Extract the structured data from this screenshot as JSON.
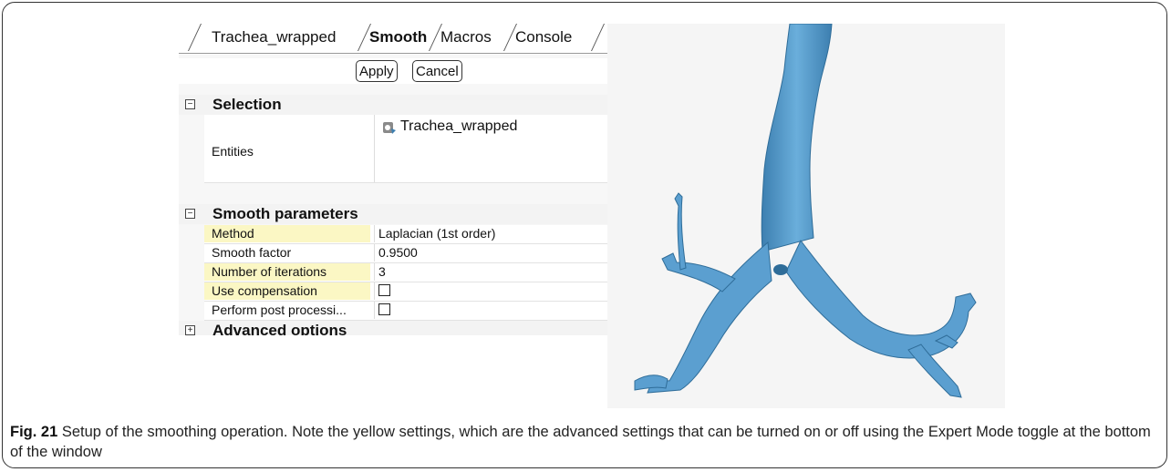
{
  "tabs": [
    "Trachea_wrapped",
    "Smooth",
    "Macros",
    "Console"
  ],
  "active_tab": "Smooth",
  "buttons": {
    "apply": "Apply",
    "cancel": "Cancel"
  },
  "sections": {
    "selection": {
      "title": "Selection",
      "toggle": "−"
    },
    "smooth_params": {
      "title": "Smooth parameters",
      "toggle": "−"
    },
    "advanced": {
      "title": "Advanced options",
      "toggle": "+"
    }
  },
  "entities": {
    "label": "Entities",
    "value": "Trachea_wrapped"
  },
  "params": [
    {
      "label": "Method",
      "value": "Laplacian (1st order)",
      "advanced": true,
      "type": "text"
    },
    {
      "label": "Smooth factor",
      "value": "0.9500",
      "advanced": false,
      "type": "text"
    },
    {
      "label": "Number of iterations",
      "value": "3",
      "advanced": true,
      "type": "text"
    },
    {
      "label": "Use compensation",
      "value": "",
      "advanced": true,
      "type": "checkbox",
      "checked": false
    },
    {
      "label": "Perform post processi...",
      "value": "",
      "advanced": false,
      "type": "checkbox",
      "checked": false
    }
  ],
  "colors": {
    "advanced_highlight": "#fbf7c4",
    "mesh": "#5b9fd0",
    "mesh_dark": "#3d7fb0"
  },
  "caption": {
    "label": "Fig. 21",
    "text": " Setup of the smoothing operation. Note the yellow settings, which are the advanced settings that can be turned on or off using the Expert Mode toggle at the bottom of the window"
  }
}
